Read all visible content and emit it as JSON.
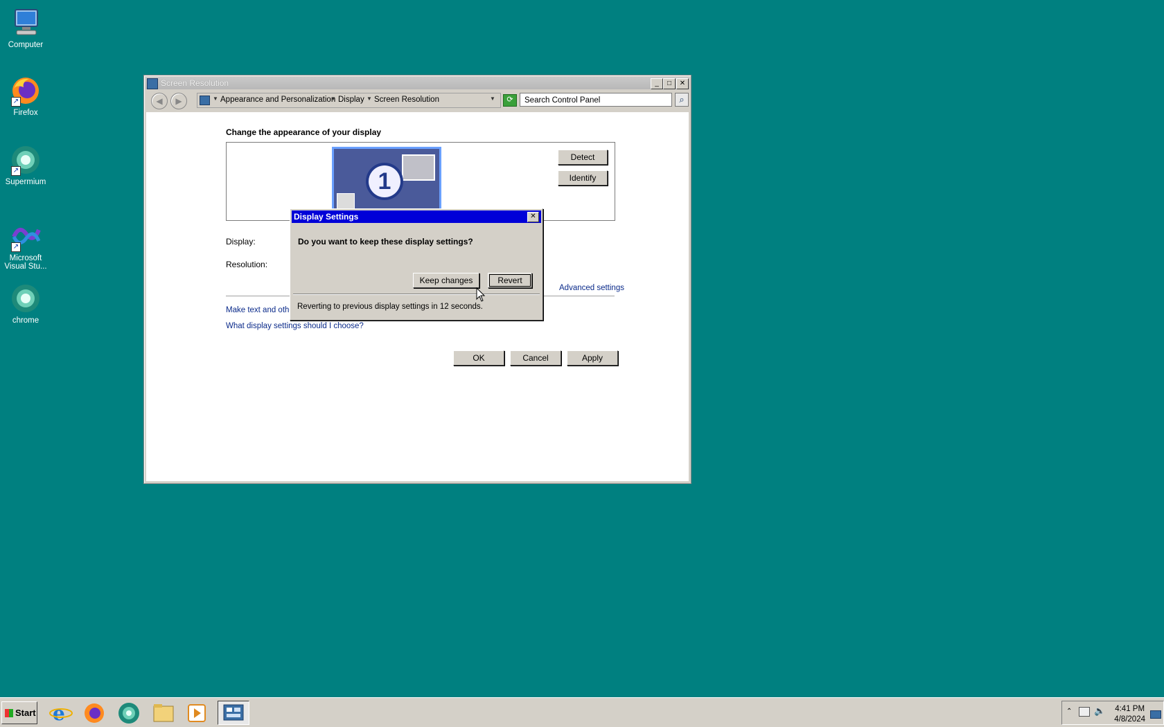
{
  "desktop": {
    "icons": [
      {
        "label": "Computer"
      },
      {
        "label": "Firefox"
      },
      {
        "label": "Supermium"
      },
      {
        "label": "Microsoft Visual Stu..."
      },
      {
        "label": "chrome"
      }
    ]
  },
  "window": {
    "title": "Screen Resolution",
    "breadcrumb": [
      "Appearance and Personalization",
      "Display",
      "Screen Resolution"
    ],
    "search_placeholder": "Search Control Panel",
    "heading": "Change the appearance of your display",
    "monitor_number": "1",
    "detect_label": "Detect",
    "identify_label": "Identify",
    "display_label": "Display:",
    "resolution_label": "Resolution:",
    "advanced_link": "Advanced settings",
    "text_link": "Make text and othe",
    "help_link": "What display settings should I choose?",
    "ok_label": "OK",
    "cancel_label": "Cancel",
    "apply_label": "Apply"
  },
  "dialog": {
    "title": "Display Settings",
    "question": "Do you want to keep these display settings?",
    "keep_label": "Keep changes",
    "revert_label": "Revert",
    "status": "Reverting to previous display settings in 12 seconds."
  },
  "taskbar": {
    "start_label": "Start",
    "apps": [
      "internet-explorer-icon",
      "firefox-icon",
      "supermium-icon",
      "file-explorer-icon",
      "media-player-icon",
      "control-panel-icon"
    ],
    "time": "4:41 PM",
    "date": "4/8/2024"
  }
}
